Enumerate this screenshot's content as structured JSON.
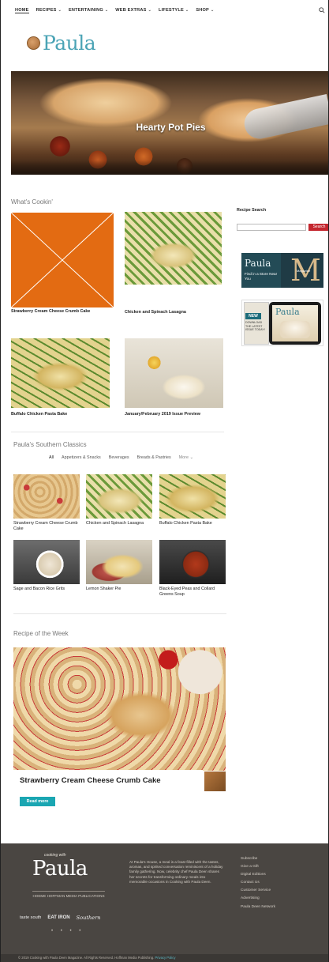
{
  "nav": {
    "items": [
      {
        "label": "HOME",
        "has_dropdown": false
      },
      {
        "label": "RECIPES",
        "has_dropdown": true
      },
      {
        "label": "ENTERTAINING",
        "has_dropdown": true
      },
      {
        "label": "WEB EXTRAS",
        "has_dropdown": true
      },
      {
        "label": "LIFESTYLE",
        "has_dropdown": true
      },
      {
        "label": "SHOP",
        "has_dropdown": true
      }
    ],
    "search_icon": "search-icon"
  },
  "logo": {
    "text": "Paula"
  },
  "hero": {
    "title": "Hearty Pot Pies"
  },
  "whats_cookin": {
    "title": "What's Cookin'",
    "cards": [
      {
        "label": "Strawberry Cream Cheese Crumb Cake",
        "image": "placeholder"
      },
      {
        "label": "Chicken and Spinach Lasagna",
        "image": "lasagna"
      },
      {
        "label": "Buffalo Chicken Pasta Bake",
        "image": "casserole"
      },
      {
        "label": "January/February 2019 Issue Preview",
        "image": "dessert"
      }
    ]
  },
  "sidebar": {
    "search_label": "Recipe Search",
    "search_placeholder": "",
    "search_button": "Search",
    "ad1": {
      "brand": "Paula",
      "text": "Find in a Store Near You",
      "letter": "M",
      "sub": "Magazine"
    },
    "ad2": {
      "badge": "NEW",
      "text": "DOWNLOAD THE LATEST ISSUE TODAY!",
      "brand": "Paula"
    }
  },
  "southern": {
    "title": "Paula's Southern Classics",
    "filters": [
      "All",
      "Appetizers & Snacks",
      "Beverages",
      "Breads & Pastries",
      "More"
    ],
    "cards": [
      {
        "label": "Strawberry Cream Cheese Crumb Cake",
        "image": "crumb"
      },
      {
        "label": "Chicken and Spinach Lasagna",
        "image": "lasagna"
      },
      {
        "label": "Buffalo Chicken Pasta Bake",
        "image": "casserole"
      },
      {
        "label": "Sage and Bacon Rice Grits",
        "image": "soup"
      },
      {
        "label": "Lemon Shaker Pie",
        "image": "pie"
      },
      {
        "label": "Black-Eyed Peas and Collard Greens Soup",
        "image": "stew"
      }
    ]
  },
  "recipe_of_week": {
    "title": "Recipe of the Week",
    "caption": "Strawberry Cream Cheese Crumb Cake",
    "button": "Read more"
  },
  "footer": {
    "cooking_with": "cooking with",
    "logo": "Paula",
    "publisher": "HOEME HOFFMAN MEDIA PUBLICATIONS",
    "brands": [
      "taste south",
      "EAT IRON",
      "Southern"
    ],
    "about": "At Paula's House, a meal is a feast filled with the tastes, aromas, and spirited conversation reminiscent of a holiday family gathering. Now, celebrity chef Paula Deen shares her secrets for transforming ordinary meals into memorable occasions in Cooking with Paula Deen.",
    "links": [
      "Subscribe",
      "Give a Gift",
      "Digital Editions",
      "Contact Us",
      "Customer Service",
      "Advertising",
      "Paula Deen Network"
    ],
    "copyright": "© 2019 Cooking with Paula Deen Magazine. All Rights Reserved. Hoffman Media Publishing.",
    "privacy": "Privacy Policy"
  }
}
